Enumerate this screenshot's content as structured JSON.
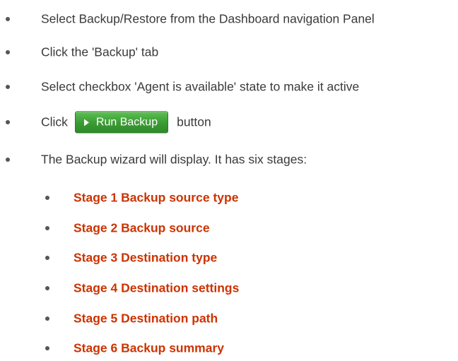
{
  "steps": [
    {
      "text": "Select Backup/Restore from the Dashboard navigation Panel"
    },
    {
      "text": "Click the 'Backup' tab"
    },
    {
      "text": "Select checkbox  'Agent is available' state to make it active"
    },
    {
      "before": "Click",
      "button": "Run Backup",
      "after": "button"
    },
    {
      "text": "The Backup wizard will display. It has six stages:"
    }
  ],
  "stages": [
    "Stage 1 Backup source type",
    "Stage 2 Backup source",
    "Stage 3 Destination type",
    "Stage 4 Destination settings",
    "Stage 5 Destination path",
    "Stage 6 Backup summary"
  ],
  "colors": {
    "stage_link": "#cc3300",
    "button_green": "#3a9a33"
  },
  "icons": {
    "bullet": "bullet-icon",
    "button": "play-icon"
  }
}
